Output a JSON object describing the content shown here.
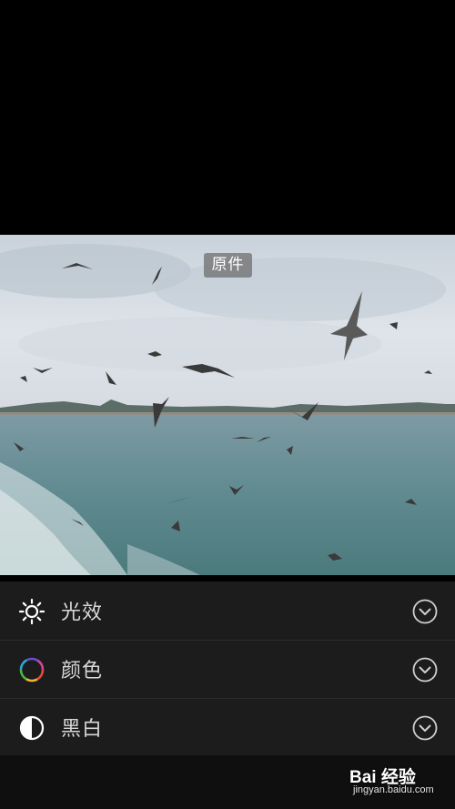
{
  "photo": {
    "badge": "原件"
  },
  "menu": {
    "items": [
      {
        "label": "光效",
        "icon": "sun-icon"
      },
      {
        "label": "颜色",
        "icon": "color-wheel-icon"
      },
      {
        "label": "黑白",
        "icon": "half-circle-icon"
      }
    ],
    "expand_icon": "chevron-down-circle-icon"
  },
  "watermark": {
    "brand": "Bai 经验",
    "url": "jingyan.baidu.com"
  },
  "colors": {
    "panel": "#1c1c1c",
    "text": "#d9d9d9",
    "background": "#000000"
  }
}
